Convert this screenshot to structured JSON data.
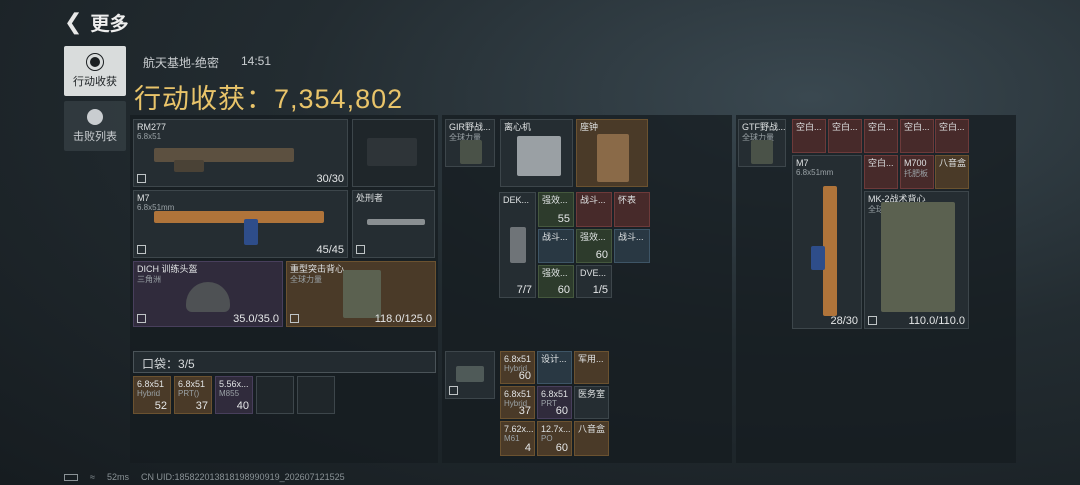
{
  "header": {
    "title": "更多",
    "map": "航天基地-绝密",
    "time": "14:51",
    "total_label": "行动收获：",
    "total_value": "7,354,802"
  },
  "side": {
    "tab1": "行动收获",
    "tab2": "击败列表"
  },
  "weapon1": {
    "name": "RM277",
    "sub": "6.8x51",
    "ammo": "30/30"
  },
  "weapon2": {
    "name": "M7",
    "sub": "6.8x51mm",
    "ammo": "45/45"
  },
  "knife": {
    "name": "处刑者"
  },
  "helmet": {
    "name": "DICH 训练头盔",
    "sub": "三角洲",
    "dur": "35.0/35.0"
  },
  "armor": {
    "name": "重型突击背心",
    "sub": "全球力量",
    "dur": "118.0/125.0"
  },
  "rig1": {
    "name": "GIR野战...",
    "sub": "全球力量"
  },
  "items1": [
    {
      "name": "离心机"
    },
    {
      "name": "座钟"
    }
  ],
  "meds": [
    {
      "name": "DEK...",
      "q": "7/7"
    },
    {
      "name": "强效...",
      "q": "55"
    },
    {
      "name": "战斗...",
      "q": ""
    },
    {
      "name": "怀表",
      "q": ""
    },
    {
      "name": "战斗...",
      "q": ""
    },
    {
      "name": "强效...",
      "q": "60"
    },
    {
      "name": "战斗...",
      "q": ""
    },
    {
      "name": "强效...",
      "q": "60"
    },
    {
      "name": "DVE...",
      "q": "1/5"
    }
  ],
  "pocket": {
    "label": "口袋：",
    "count": "3/5"
  },
  "pocket_items": [
    {
      "name": "6.8x51",
      "sub": "Hybrid",
      "q": "52"
    },
    {
      "name": "6.8x51",
      "sub": "PRT()",
      "q": "37"
    },
    {
      "name": "5.56x...",
      "sub": "M855",
      "q": "40"
    }
  ],
  "bag_items": [
    {
      "name": "6.8x51",
      "sub": "Hybrid",
      "q": "60"
    },
    {
      "name": "设计...",
      "sub": "",
      "q": ""
    },
    {
      "name": "军用...",
      "sub": "",
      "q": ""
    },
    {
      "name": "6.8x51",
      "sub": "Hybrid",
      "q": "37"
    },
    {
      "name": "6.8x51",
      "sub": "PRT",
      "q": "60"
    },
    {
      "name": "医务室",
      "sub": "",
      "q": ""
    },
    {
      "name": "7.62x...",
      "sub": "M61",
      "q": "4"
    },
    {
      "name": "12.7x...",
      "sub": "PO",
      "q": "60"
    },
    {
      "name": "八音盒",
      "sub": "",
      "q": ""
    }
  ],
  "rig2": {
    "name": "GTF野战...",
    "sub": "全球力量"
  },
  "empties": [
    "空白...",
    "空白...",
    "空白...",
    "空白...",
    "空白..."
  ],
  "right2": [
    {
      "name": "M7",
      "sub": "6.8x51mm"
    },
    {
      "name": "空白...",
      "sub": ""
    },
    {
      "name": "M700",
      "sub": "托肥板"
    },
    {
      "name": "八音盒",
      "sub": ""
    }
  ],
  "right_weapon": {
    "ammo": "28/30"
  },
  "right_armor": {
    "name": "MK-2战术背心",
    "sub": "全球力量",
    "dur": "110.0/110.0"
  },
  "status": {
    "ping": "52ms",
    "uid": "CN UID:185822013818198990919_202607121525"
  }
}
